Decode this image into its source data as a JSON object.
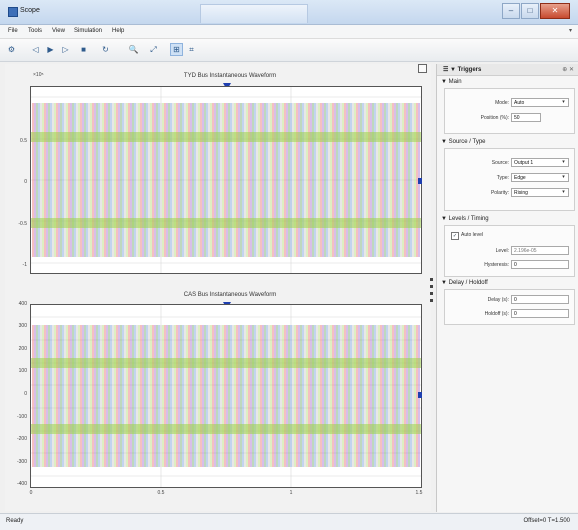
{
  "window": {
    "title": "Scope",
    "colors": {
      "titlebar": "#c4d7ee",
      "close": "#c74a30"
    }
  },
  "menu": [
    {
      "id": "file",
      "label": "File"
    },
    {
      "id": "tools",
      "label": "Tools"
    },
    {
      "id": "view",
      "label": "View"
    },
    {
      "id": "simulation",
      "label": "Simulation"
    },
    {
      "id": "help",
      "label": "Help"
    }
  ],
  "toolbar": {
    "buttons": [
      {
        "name": "settings-icon",
        "glyph": "⚙"
      },
      {
        "name": "step-back-icon",
        "glyph": "◁"
      },
      {
        "name": "run-icon",
        "glyph": "▶"
      },
      {
        "name": "step-forward-icon",
        "glyph": "▷"
      },
      {
        "name": "stop-icon",
        "glyph": "■"
      },
      {
        "name": "highlight-icon",
        "glyph": "↻"
      },
      {
        "name": "zoom-icon",
        "glyph": "🔍"
      },
      {
        "name": "autoscale-icon",
        "glyph": "⤢"
      },
      {
        "name": "triggers-icon",
        "glyph": "⊞"
      },
      {
        "name": "measurements-icon",
        "glyph": "⌗"
      }
    ]
  },
  "plots": [
    {
      "title": "TYD Bus Instantaneous Waveform",
      "exponent": "×10⁵",
      "yticks": [
        "",
        "0.5",
        "0",
        "-0.5",
        "-1"
      ],
      "xticks": []
    },
    {
      "title": "CAS Bus Instantaneous Waveform",
      "exponent": "",
      "yticks": [
        "400",
        "300",
        "200",
        "100",
        "0",
        "-100",
        "-200",
        "-300",
        "-400"
      ],
      "xticks": [
        "0",
        "0.5",
        "1",
        "1.5"
      ]
    }
  ],
  "waveform_colors": [
    "#e04848",
    "#8c3fbf",
    "#3f8c3f",
    "#4a7fd1",
    "#b8b8b8",
    "#9fd14a"
  ],
  "triggers_panel": {
    "title": "Triggers",
    "header_buttons": "⊕ ✕",
    "sections": {
      "main": {
        "label": "Main",
        "mode_label": "Mode:",
        "mode_value": "Auto",
        "position_label": "Position (%):",
        "position_value": "50"
      },
      "source": {
        "label": "Source / Type",
        "source_label": "Source:",
        "source_value": "Output 1",
        "type_label": "Type:",
        "type_value": "Edge",
        "polarity_label": "Polarity:",
        "polarity_value": "Rising"
      },
      "levels": {
        "label": "Levels / Timing",
        "auto_level_label": "Auto level",
        "level_label": "Level:",
        "level_value": "2.196e-05",
        "hysteresis_label": "Hysteresis:",
        "hysteresis_value": "0"
      },
      "delay": {
        "label": "Delay / Holdoff",
        "delay_label": "Delay (s):",
        "delay_value": "0",
        "holdoff_label": "Holdoff (s):",
        "holdoff_value": "0"
      }
    }
  },
  "status": {
    "left": "Ready",
    "right": "Offset=0  T=1.500"
  }
}
